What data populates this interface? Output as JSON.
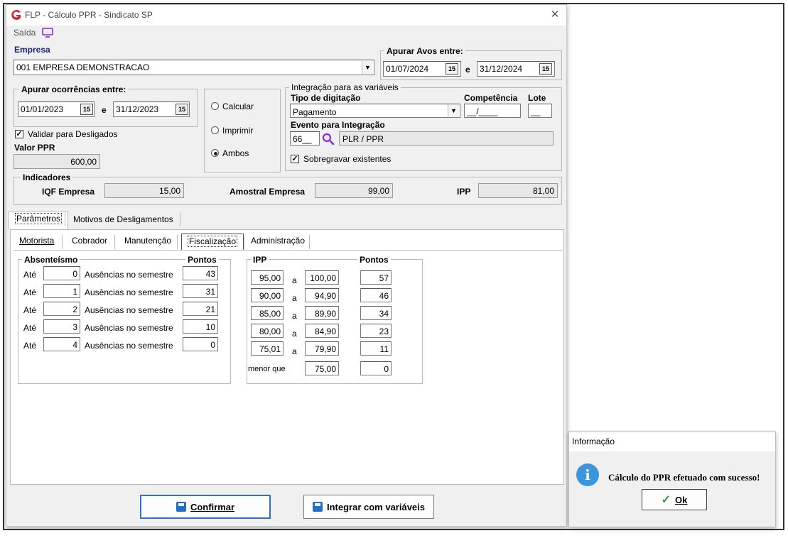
{
  "window": {
    "title": "FLP - Cálculo PPR - Sindicato SP",
    "close_glyph": "✕"
  },
  "menu": {
    "saida": "Saída"
  },
  "empresa": {
    "label": "Empresa",
    "value": "001 EMPRESA DEMONSTRACAO"
  },
  "avos": {
    "label": "Apurar Avos entre:",
    "from": "01/07/2024",
    "sep": "e",
    "to": "31/12/2024"
  },
  "ocorrencias": {
    "label": "Apurar ocorrências entre:",
    "from": "01/01/2023",
    "sep": "e",
    "to": "31/12/2023"
  },
  "calendar_glyph": "15",
  "validar": {
    "label": "Validar para Desligados",
    "checked": true
  },
  "valor_ppr": {
    "label": "Valor PPR",
    "value": "600,00"
  },
  "modo": {
    "options": [
      "Calcular",
      "Imprimir",
      "Ambos"
    ],
    "selected": "Ambos"
  },
  "integracao": {
    "group_label": "Integração para as variáveis",
    "tipo_label": "Tipo de digitação",
    "tipo_value": "Pagamento",
    "competencia_label": "Competência",
    "competencia_value": "__/____",
    "lote_label": "Lote",
    "lote_value": "__",
    "evento_label": "Evento para Integração",
    "evento_code": "66__",
    "evento_desc": "PLR / PPR",
    "sobregravar_label": "Sobregravar existentes"
  },
  "indicadores": {
    "label": "Indicadores",
    "iqf_label": "IQF Empresa",
    "iqf_value": "15,00",
    "amostral_label": "Amostral Empresa",
    "amostral_value": "99,00",
    "ipp_label": "IPP",
    "ipp_value": "81,00"
  },
  "tabs_main": [
    "Parâmetros",
    "Motivos de Desligamentos"
  ],
  "tabs_sub": [
    "Motorista",
    "Cobrador",
    "Manutenção",
    "Fiscalização",
    "Administração"
  ],
  "absenteismo": {
    "label": "Absenteísmo",
    "pontos_label": "Pontos",
    "ate": "Até",
    "desc": "Ausências no semestre",
    "rows": [
      {
        "n": "0",
        "pontos": "43"
      },
      {
        "n": "1",
        "pontos": "31"
      },
      {
        "n": "2",
        "pontos": "21"
      },
      {
        "n": "3",
        "pontos": "10"
      },
      {
        "n": "4",
        "pontos": "0"
      }
    ]
  },
  "ipp_table": {
    "label": "IPP",
    "pontos_label": "Pontos",
    "a": "a",
    "menor_que": "menor que",
    "rows": [
      {
        "from": "95,00",
        "to": "100,00",
        "pontos": "57"
      },
      {
        "from": "90,00",
        "to": "94,90",
        "pontos": "46"
      },
      {
        "from": "85,00",
        "to": "89,90",
        "pontos": "34"
      },
      {
        "from": "80,00",
        "to": "84,90",
        "pontos": "23"
      },
      {
        "from": "75,01",
        "to": "79,90",
        "pontos": "11"
      }
    ],
    "last": {
      "to": "75,00",
      "pontos": "0"
    }
  },
  "buttons": {
    "confirmar": "Confirmar",
    "integrar": "Integrar com variáveis"
  },
  "dialog": {
    "title": "Informação",
    "message": "Cálculo do PPR efetuado com sucesso!",
    "ok": "Ok",
    "icon_glyph": "i"
  },
  "colors": {
    "logo": "#d9232e",
    "accent": "#2f6fd6",
    "info": "#3d96dd",
    "purple": "#8a2be2"
  }
}
